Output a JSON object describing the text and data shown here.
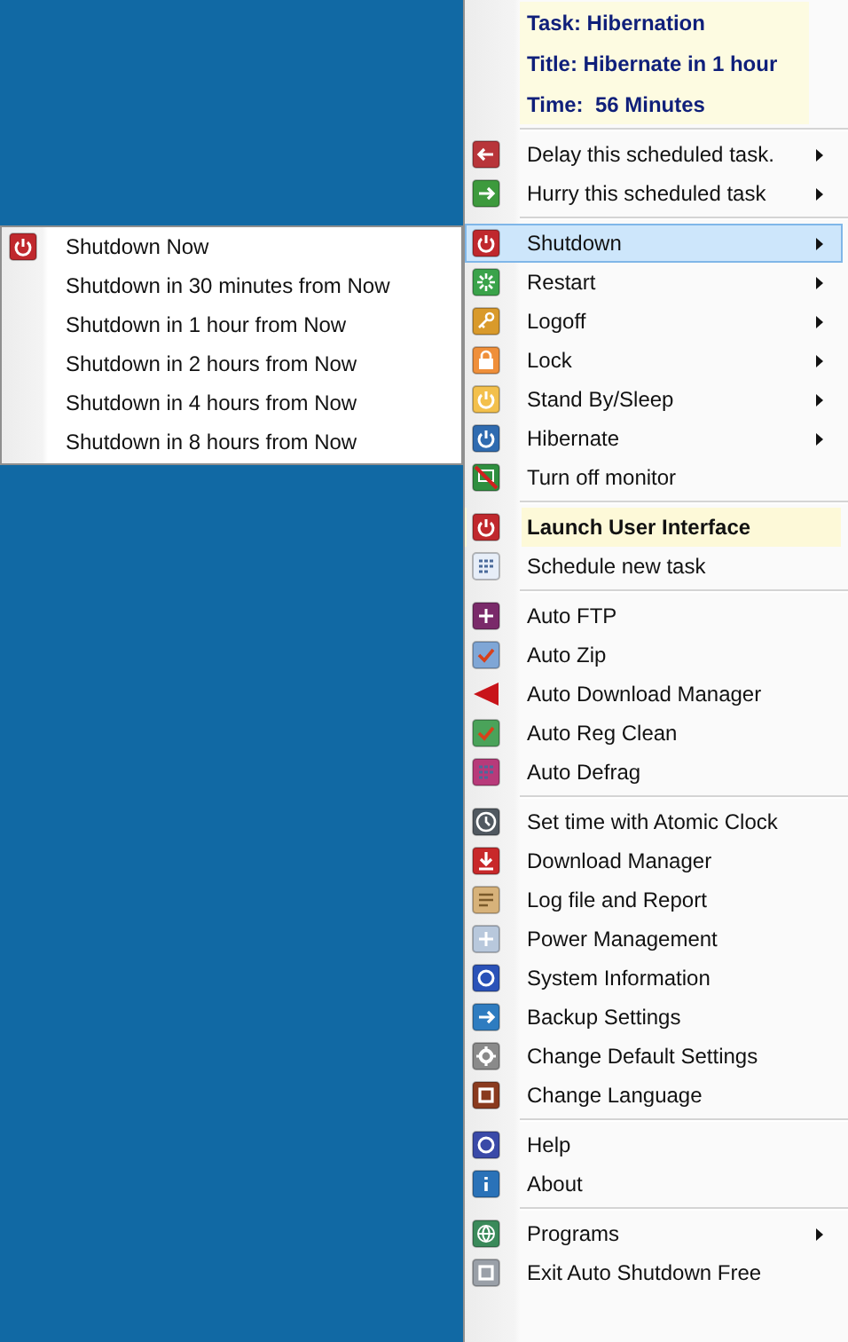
{
  "menu": {
    "info": [
      "Task: Hibernation",
      "Title: Hibernate in 1 hour",
      "Time:  56 Minutes"
    ],
    "groups": [
      {
        "items": [
          {
            "label": "Delay this scheduled task.",
            "has_submenu": true,
            "selected": false,
            "default": false
          },
          {
            "label": "Hurry this scheduled task",
            "has_submenu": true,
            "selected": false,
            "default": false
          }
        ]
      },
      {
        "items": [
          {
            "label": "Shutdown",
            "has_submenu": true,
            "selected": true,
            "default": false
          },
          {
            "label": "Restart",
            "has_submenu": true,
            "selected": false,
            "default": false
          },
          {
            "label": "Logoff",
            "has_submenu": true,
            "selected": false,
            "default": false
          },
          {
            "label": "Lock",
            "has_submenu": true,
            "selected": false,
            "default": false
          },
          {
            "label": "Stand By/Sleep",
            "has_submenu": true,
            "selected": false,
            "default": false
          },
          {
            "label": "Hibernate",
            "has_submenu": true,
            "selected": false,
            "default": false
          },
          {
            "label": "Turn off monitor",
            "has_submenu": false,
            "selected": false,
            "default": false
          }
        ]
      },
      {
        "items": [
          {
            "label": "Launch User Interface",
            "has_submenu": false,
            "selected": false,
            "default": true
          },
          {
            "label": "Schedule new task",
            "has_submenu": false,
            "selected": false,
            "default": false
          }
        ]
      },
      {
        "items": [
          {
            "label": "Auto FTP",
            "has_submenu": false,
            "selected": false,
            "default": false
          },
          {
            "label": "Auto Zip",
            "has_submenu": false,
            "selected": false,
            "default": false
          },
          {
            "label": "Auto Download Manager",
            "has_submenu": false,
            "selected": false,
            "default": false
          },
          {
            "label": "Auto Reg Clean",
            "has_submenu": false,
            "selected": false,
            "default": false
          },
          {
            "label": "Auto Defrag",
            "has_submenu": false,
            "selected": false,
            "default": false
          }
        ]
      },
      {
        "items": [
          {
            "label": "Set time with Atomic Clock",
            "has_submenu": false,
            "selected": false,
            "default": false
          },
          {
            "label": "Download Manager",
            "has_submenu": false,
            "selected": false,
            "default": false
          },
          {
            "label": "Log file and Report",
            "has_submenu": false,
            "selected": false,
            "default": false
          },
          {
            "label": "Power Management",
            "has_submenu": false,
            "selected": false,
            "default": false
          },
          {
            "label": "System Information",
            "has_submenu": false,
            "selected": false,
            "default": false
          },
          {
            "label": "Backup Settings",
            "has_submenu": false,
            "selected": false,
            "default": false
          },
          {
            "label": "Change Default Settings",
            "has_submenu": false,
            "selected": false,
            "default": false
          },
          {
            "label": "Change Language",
            "has_submenu": false,
            "selected": false,
            "default": false
          }
        ]
      },
      {
        "items": [
          {
            "label": "Help",
            "has_submenu": false,
            "selected": false,
            "default": false
          },
          {
            "label": "About",
            "has_submenu": false,
            "selected": false,
            "default": false
          }
        ]
      },
      {
        "items": [
          {
            "label": "Programs",
            "has_submenu": true,
            "selected": false,
            "default": false
          },
          {
            "label": "Exit Auto Shutdown Free",
            "has_submenu": false,
            "selected": false,
            "default": false
          }
        ]
      }
    ]
  },
  "submenu": {
    "items": [
      {
        "label": "Shutdown Now"
      },
      {
        "label": "Shutdown in 30 minutes from Now"
      },
      {
        "label": "Shutdown in 1 hour from Now"
      },
      {
        "label": "Shutdown in 2 hours from Now"
      },
      {
        "label": "Shutdown in 4 hours from Now"
      },
      {
        "label": "Shutdown in 8 hours from Now"
      }
    ]
  }
}
